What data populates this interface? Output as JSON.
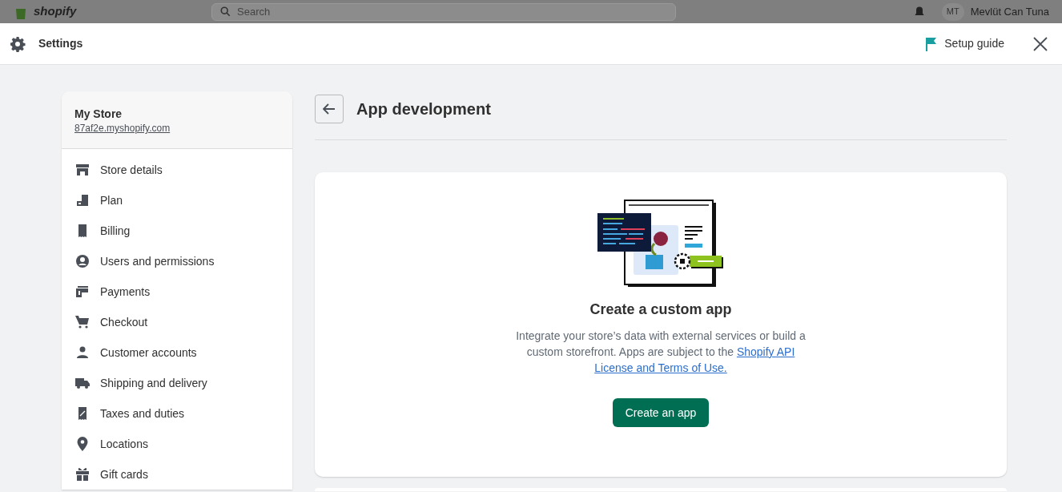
{
  "backdrop": {
    "logo": "shopify",
    "search": {
      "placeholder": "Search"
    },
    "avatar": "MT",
    "user": "Mevlüt Can Tuna"
  },
  "header": {
    "title": "Settings",
    "setup_guide": "Setup guide"
  },
  "store": {
    "name": "My Store",
    "domain": "87af2e.myshopify.com"
  },
  "nav": [
    {
      "label": "Store details"
    },
    {
      "label": "Plan"
    },
    {
      "label": "Billing"
    },
    {
      "label": "Users and permissions"
    },
    {
      "label": "Payments"
    },
    {
      "label": "Checkout"
    },
    {
      "label": "Customer accounts"
    },
    {
      "label": "Shipping and delivery"
    },
    {
      "label": "Taxes and duties"
    },
    {
      "label": "Locations"
    },
    {
      "label": "Gift cards"
    }
  ],
  "page": {
    "title": "App development"
  },
  "card": {
    "title": "Create a custom app",
    "text": "Integrate your store’s data with external services or build a custom storefront. Apps are subject to the ",
    "link_lines": [
      "Shopify API",
      "License and Terms of Use."
    ],
    "button": "Create an app"
  }
}
